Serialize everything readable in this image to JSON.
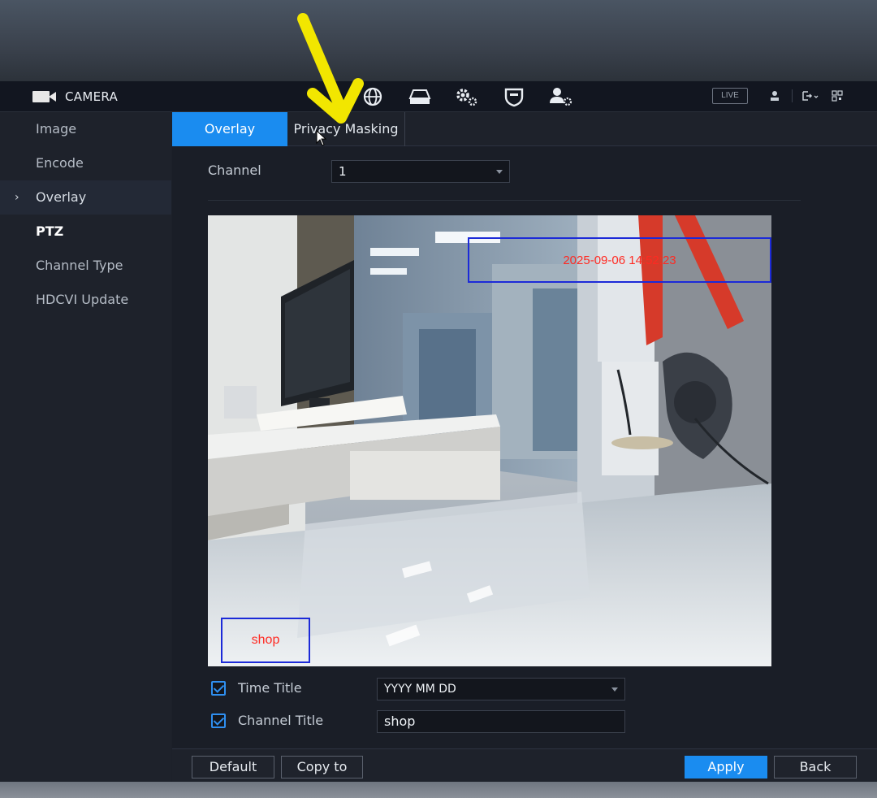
{
  "app": {
    "title": "CAMERA"
  },
  "topbar": {
    "nav_icons": [
      "network-icon",
      "storage-icon",
      "system-settings-icon",
      "security-shield-icon",
      "account-settings-icon"
    ],
    "live_label": "LIVE"
  },
  "sidebar": {
    "items": [
      {
        "label": "Image"
      },
      {
        "label": "Encode"
      },
      {
        "label": "Overlay",
        "active": true
      },
      {
        "label": "PTZ"
      },
      {
        "label": "Channel Type"
      },
      {
        "label": "HDCVI Update"
      }
    ]
  },
  "tabs": [
    {
      "label": "Overlay",
      "active": true
    },
    {
      "label": "Privacy Masking"
    }
  ],
  "channel": {
    "label": "Channel",
    "value": "1"
  },
  "preview": {
    "time_overlay_text": "2025-09-06 14:52:23",
    "channel_overlay_text": "shop"
  },
  "time_title": {
    "label": "Time Title",
    "checked": true,
    "value": "YYYY MM DD"
  },
  "channel_title": {
    "label": "Channel Title",
    "checked": true,
    "value": "shop"
  },
  "buttons": {
    "default": "Default",
    "copy_to": "Copy to",
    "apply": "Apply",
    "back": "Back"
  },
  "colors": {
    "accent": "#1a8cf0",
    "overlay_box": "#1c2ad8",
    "overlay_text": "#ff2a22",
    "annotation_arrow": "#f2e600"
  }
}
